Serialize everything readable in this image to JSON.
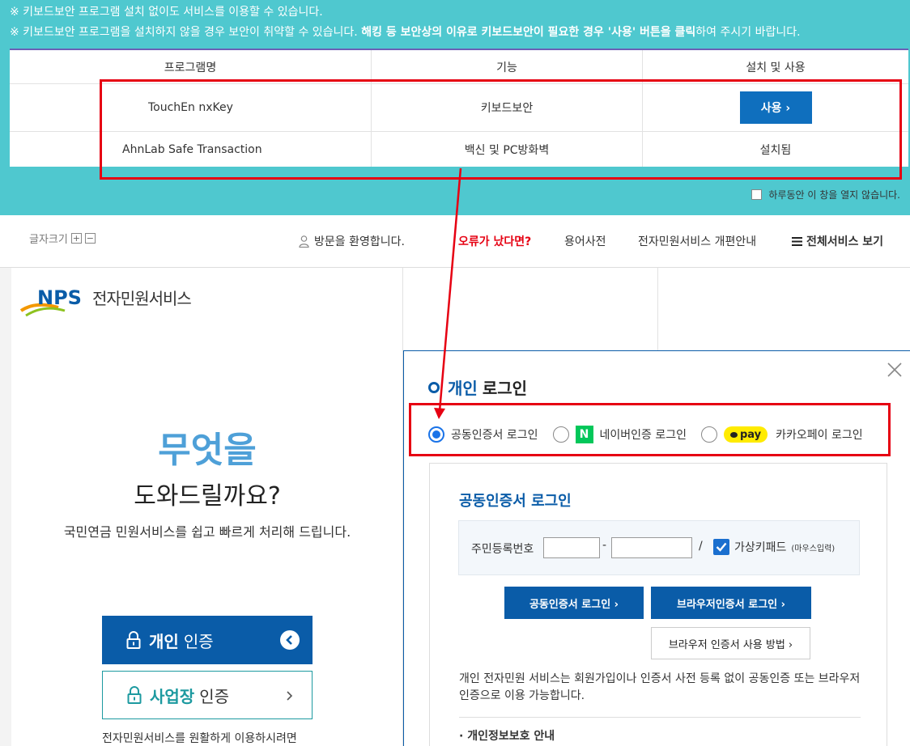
{
  "notice": {
    "line1": "※ 키보드보안 프로그램 설치 없이도 서비스를 이용할 수 있습니다.",
    "line2_a": "※ 키보드보안 프로그램을 설치하지 않을 경우 보안이 취약할 수 있습니다. ",
    "line2_b": "해킹 등 보안상의 이유로 키보드보안이 필요한 경우 '사용' 버튼을 클릭",
    "line2_c": "하여 주시기 바랍니다.",
    "table": {
      "headers": [
        "프로그램명",
        "기능",
        "설치 및 사용"
      ],
      "rows": [
        {
          "name": "TouchEn nxKey",
          "function": "키보드보안",
          "action": "사용 ›"
        },
        {
          "name": "AhnLab Safe Transaction",
          "function": "백신 및 PC방화벽",
          "action": "설치됨"
        }
      ]
    },
    "dont_open": "하루동안 이 창을 열지 않습니다."
  },
  "header": {
    "font_size": "글자크기",
    "font_plus": "+",
    "font_minus": "−",
    "welcome": "방문을 환영합니다.",
    "error": "오류가 났다면?",
    "dictionary": "용어사전",
    "reform": "전자민원서비스 개편안내",
    "all_services": "전체서비스 보기"
  },
  "left": {
    "logo_text": "전자민원서비스",
    "hero1": "무엇을",
    "hero2": "도와드릴까요?",
    "hero3": "국민연금 민원서비스를 쉽고 빠르게 처리해 드립니다.",
    "personal_b": "개인",
    "personal_rest": "인증",
    "business_b": "사업장",
    "business_rest": "인증",
    "foot": "전자민원서비스를 원활하게 이용하시려면"
  },
  "modal": {
    "title_b": "개인",
    "title_rest": "로그인",
    "radio1": "공동인증서 로그인",
    "radio2": "네이버인증 로그인",
    "naver_letter": "N",
    "radio3": "카카오페이 로그인",
    "kakao_badge": "pay",
    "box_title": "공동인증서 로그인",
    "rrn_label": "주민등록번호",
    "dash": "-",
    "slash": "/",
    "vk_label": "가상키패드",
    "vk_small": "(마우스입력)",
    "btn_cert": "공동인증서 로그인 ›",
    "btn_browser": "브라우저인증서 로그인 ›",
    "btn_howto": "브라우저 인증서 사용 방법 ›",
    "desc": "개인 전자민원 서비스는 회원가입이나 인증서 사전 등록 없이 공동인증 또는 브라우저인증으로 이용 가능합니다.",
    "privacy": "· 개인정보보호 안내"
  },
  "colors": {
    "teal": "#4fc8cf",
    "blue": "#0a5ca8",
    "red": "#e60012"
  }
}
